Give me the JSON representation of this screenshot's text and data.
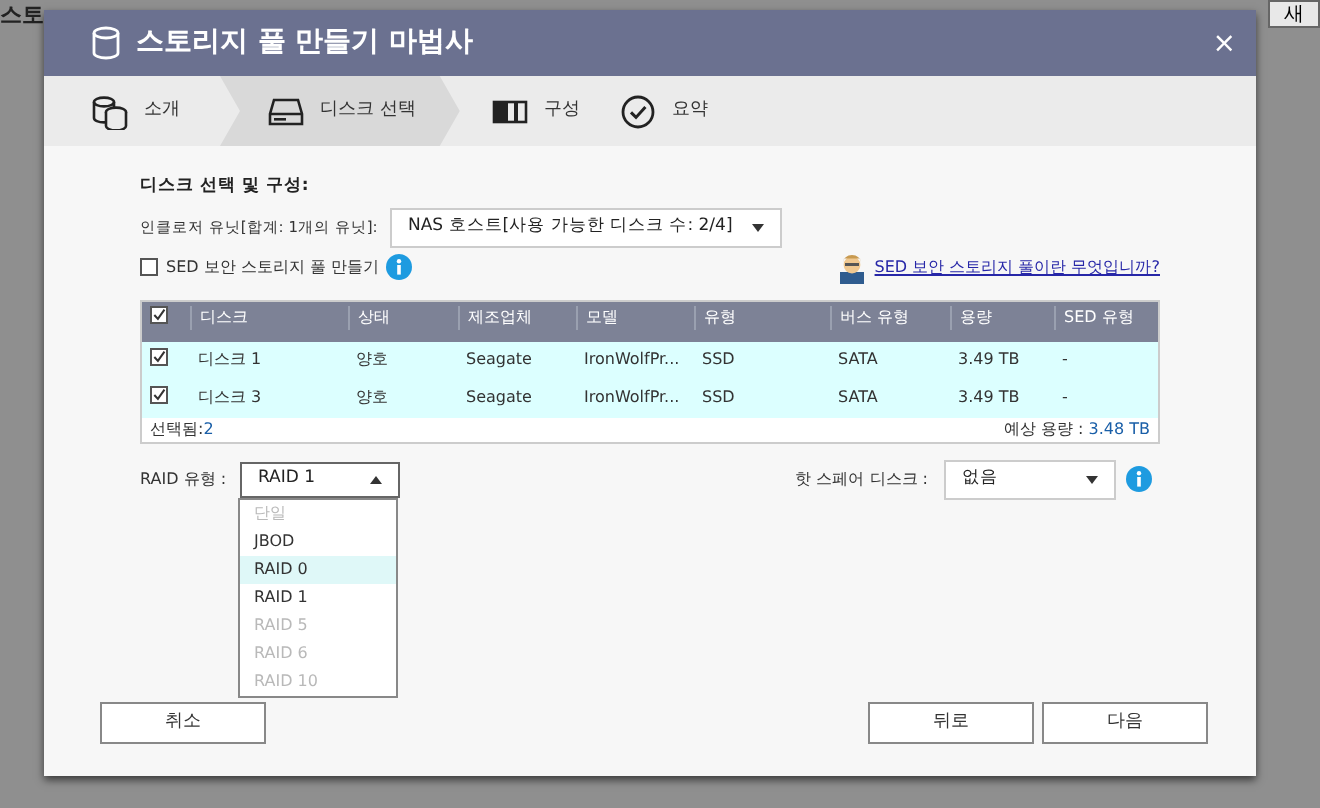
{
  "background_page": {
    "title": "스토",
    "button": "새"
  },
  "window": {
    "title": "스토리지 풀 만들기 마법사",
    "close": "×"
  },
  "steps": [
    {
      "label": "소개",
      "selected": false,
      "kind": "intro"
    },
    {
      "label": "디스크 선택",
      "selected": true,
      "kind": "disk"
    },
    {
      "label": "구성",
      "selected": false,
      "kind": "config"
    },
    {
      "label": "요약",
      "selected": false,
      "kind": "summary"
    }
  ],
  "section_title": "디스크 선택 및 구성:",
  "enclosure": {
    "label": "인클로저 유닛[합계: 1개의 유닛]:",
    "value": "NAS 호스트[사용 가능한 디스크 수: 2/4]"
  },
  "sed": {
    "label": "SED 보안 스토리지 풀 만들기",
    "checked": false,
    "help_link": "SED 보안 스토리지 풀이란 무엇입니까?"
  },
  "table": {
    "all_checked": true,
    "columns": [
      "디스크",
      "상태",
      "제조업체",
      "모델",
      "유형",
      "버스 유형",
      "용량",
      "SED 유형"
    ],
    "rows": [
      {
        "checked": true,
        "cells": [
          "디스크 1",
          "양호",
          "Seagate",
          "IronWolfPr...",
          "SSD",
          "SATA",
          "3.49 TB",
          "-"
        ]
      },
      {
        "checked": true,
        "cells": [
          "디스크 3",
          "양호",
          "Seagate",
          "IronWolfPr...",
          "SSD",
          "SATA",
          "3.49 TB",
          "-"
        ]
      }
    ],
    "selected_label": "선택됨:",
    "selected_count": "2",
    "capacity_label": "예상 용량 :",
    "capacity_value": "3.48 TB"
  },
  "raid": {
    "label": "RAID 유형 :",
    "value": "RAID 1",
    "expanded": true,
    "options": [
      {
        "label": "단일",
        "disabled": true,
        "highlighted": false
      },
      {
        "label": "JBOD",
        "disabled": false,
        "highlighted": false
      },
      {
        "label": "RAID 0",
        "disabled": false,
        "highlighted": true
      },
      {
        "label": "RAID 1",
        "disabled": false,
        "highlighted": false
      },
      {
        "label": "RAID 5",
        "disabled": true,
        "highlighted": false
      },
      {
        "label": "RAID 6",
        "disabled": true,
        "highlighted": false
      },
      {
        "label": "RAID 10",
        "disabled": true,
        "highlighted": false
      }
    ]
  },
  "hot_spare": {
    "label": "핫 스페어 디스크 :",
    "value": "없음"
  },
  "buttons": {
    "cancel": "취소",
    "back": "뒤로",
    "next": "다음"
  }
}
